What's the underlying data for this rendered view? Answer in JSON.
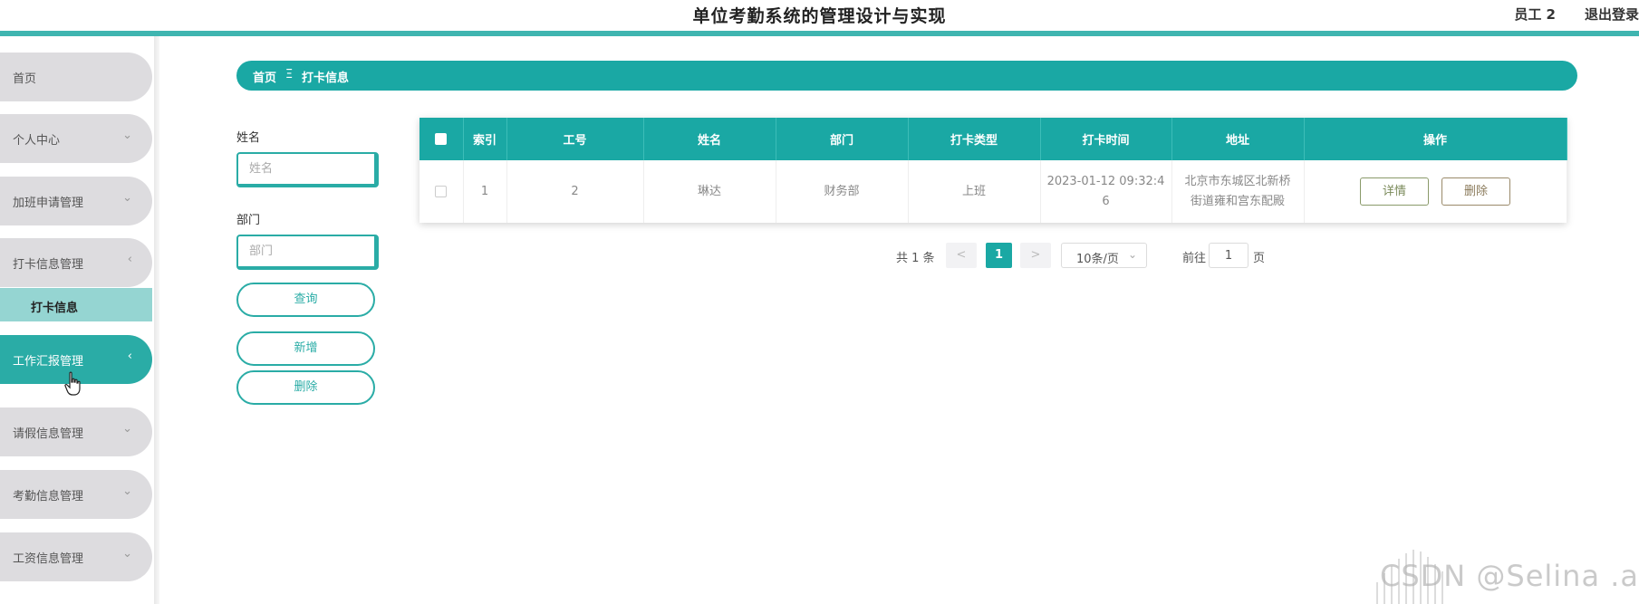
{
  "header": {
    "title": "单位考勤系统的管理设计与实现",
    "user": "员工 2",
    "logout": "退出登录"
  },
  "sidebar": {
    "items": [
      {
        "label": "首页",
        "arrow": ""
      },
      {
        "label": "个人中心",
        "arrow": "⌄"
      },
      {
        "label": "加班申请管理",
        "arrow": "⌄"
      },
      {
        "label": "打卡信息管理",
        "arrow": "‹"
      },
      {
        "label": "工作汇报管理",
        "arrow": "‹"
      },
      {
        "label": "请假信息管理",
        "arrow": "⌄"
      },
      {
        "label": "考勤信息管理",
        "arrow": "⌄"
      },
      {
        "label": "工资信息管理",
        "arrow": "⌄"
      }
    ],
    "submenu": {
      "label": "打卡信息"
    }
  },
  "breadcrumb": {
    "home": "首页",
    "separator": "Ξ",
    "current": "打卡信息"
  },
  "search": {
    "name_label": "姓名",
    "name_placeholder": "姓名",
    "dept_label": "部门",
    "dept_placeholder": "部门",
    "query_button": "查询",
    "add_button": "新增",
    "delete_button": "删除"
  },
  "table": {
    "headers": [
      "索引",
      "工号",
      "姓名",
      "部门",
      "打卡类型",
      "打卡时间",
      "地址",
      "操作"
    ],
    "rows": [
      {
        "index": "1",
        "emp_no": "2",
        "name": "琳达",
        "dept": "财务部",
        "punch_type": "上班",
        "punch_time_1": "2023-01-12 09:32:4",
        "punch_time_2": "6",
        "address_1": "北京市东城区北新桥",
        "address_2": "街道雍和宫东配殿",
        "detail_button": "详情",
        "delete_button": "删除"
      }
    ]
  },
  "pagination": {
    "total": "共 1 条",
    "prev": "<",
    "current_page": "1",
    "next": ">",
    "page_size": "10条/页",
    "goto_label": "前往",
    "goto_value": "1",
    "page_suffix": "页"
  },
  "watermark": "CSDN @Selina .a",
  "colors": {
    "primary": "#1aa8a4",
    "active_menu": "#2aaca6",
    "submenu": "#95d5d2",
    "menu_bg": "#dddcdf"
  }
}
